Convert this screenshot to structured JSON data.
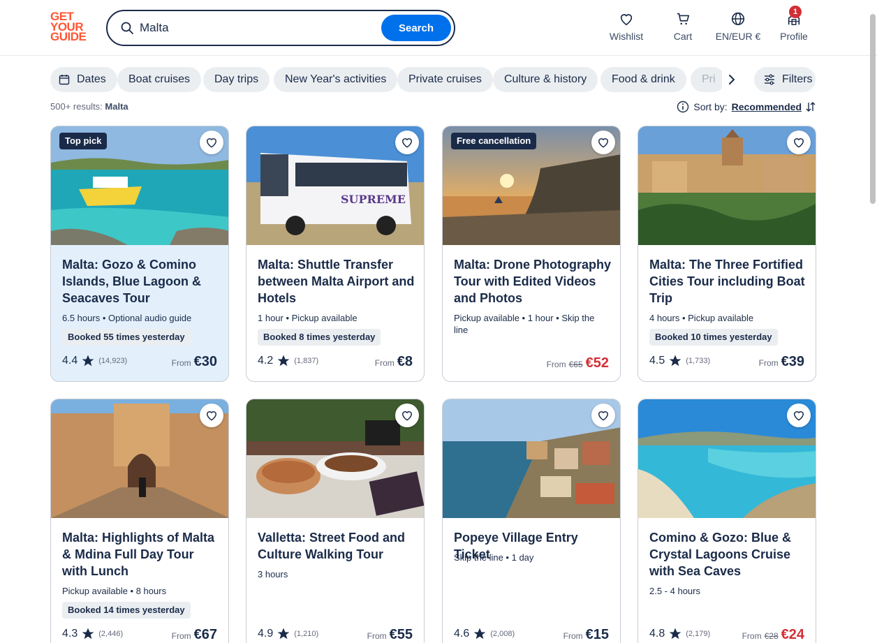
{
  "logo": {
    "line1": "GET",
    "line2": "YOUR",
    "line3": "GUIDE"
  },
  "search": {
    "value": "Malta",
    "button": "Search"
  },
  "nav": {
    "wishlist": "Wishlist",
    "cart": "Cart",
    "language": "EN/EUR €",
    "profile": "Profile",
    "profile_badge": "1"
  },
  "chips": [
    "Dates",
    "Boat cruises",
    "Day trips",
    "New Year's activities",
    "Private cruises",
    "Culture & history",
    "Food & drink",
    "Pri"
  ],
  "filters_label": "Filters",
  "results": {
    "count": "500+ results:",
    "query": "Malta"
  },
  "sort": {
    "label": "Sort by:",
    "value": "Recommended"
  },
  "cards": [
    {
      "tag": "Top pick",
      "title": "Malta: Gozo & Comino Islands, Blue Lagoon & Seacaves Tour",
      "meta": "6.5 hours • Optional audio guide",
      "booked": "Booked 55 times yesterday",
      "rating": "4.4",
      "reviews": "(14,923)",
      "from": "From",
      "old_price": "",
      "price": "€30"
    },
    {
      "tag": "",
      "title": "Malta: Shuttle Transfer between Malta Airport and Hotels",
      "meta": "1 hour • Pickup available",
      "booked": "Booked 8 times yesterday",
      "rating": "4.2",
      "reviews": "(1,837)",
      "from": "From",
      "old_price": "",
      "price": "€8"
    },
    {
      "tag": "Free cancellation",
      "title": "Malta: Drone Photography Tour with Edited Videos and Photos",
      "meta": "Pickup available • 1 hour • Skip the line",
      "booked": "",
      "rating": "",
      "reviews": "",
      "from": "From",
      "old_price": "€65",
      "price": "€52"
    },
    {
      "tag": "",
      "title": "Malta: The Three Fortified Cities Tour including Boat Trip",
      "meta": "4 hours • Pickup available",
      "booked": "Booked 10 times yesterday",
      "rating": "4.5",
      "reviews": "(1,733)",
      "from": "From",
      "old_price": "",
      "price": "€39"
    },
    {
      "tag": "",
      "title": "Malta: Highlights of Malta & Mdina Full Day Tour with Lunch",
      "meta": "Pickup available • 8 hours",
      "booked": "Booked 14 times yesterday",
      "rating": "4.3",
      "reviews": "(2,446)",
      "from": "From",
      "old_price": "",
      "price": "€67"
    },
    {
      "tag": "",
      "title": "Valletta: Street Food and Culture Walking Tour",
      "meta": "3 hours",
      "booked": "",
      "rating": "4.9",
      "reviews": "(1,210)",
      "from": "From",
      "old_price": "",
      "price": "€55"
    },
    {
      "tag": "",
      "title": "Popeye Village Entry Ticket",
      "meta": "Skip the line • 1 day",
      "booked": "",
      "rating": "4.6",
      "reviews": "(2,008)",
      "from": "From",
      "old_price": "",
      "price": "€15"
    },
    {
      "tag": "",
      "title": "Comino & Gozo: Blue & Crystal Lagoons Cruise with Sea Caves",
      "meta": "2.5 - 4 hours",
      "booked": "",
      "rating": "4.8",
      "reviews": "(2,179)",
      "from": "From",
      "old_price": "€28",
      "price": "€24"
    }
  ],
  "colors": {
    "brand": "#ff5533",
    "primary": "#0071eb",
    "text": "#1a2b49",
    "sale": "#d42e35",
    "highlight": "#e3f0fc"
  }
}
